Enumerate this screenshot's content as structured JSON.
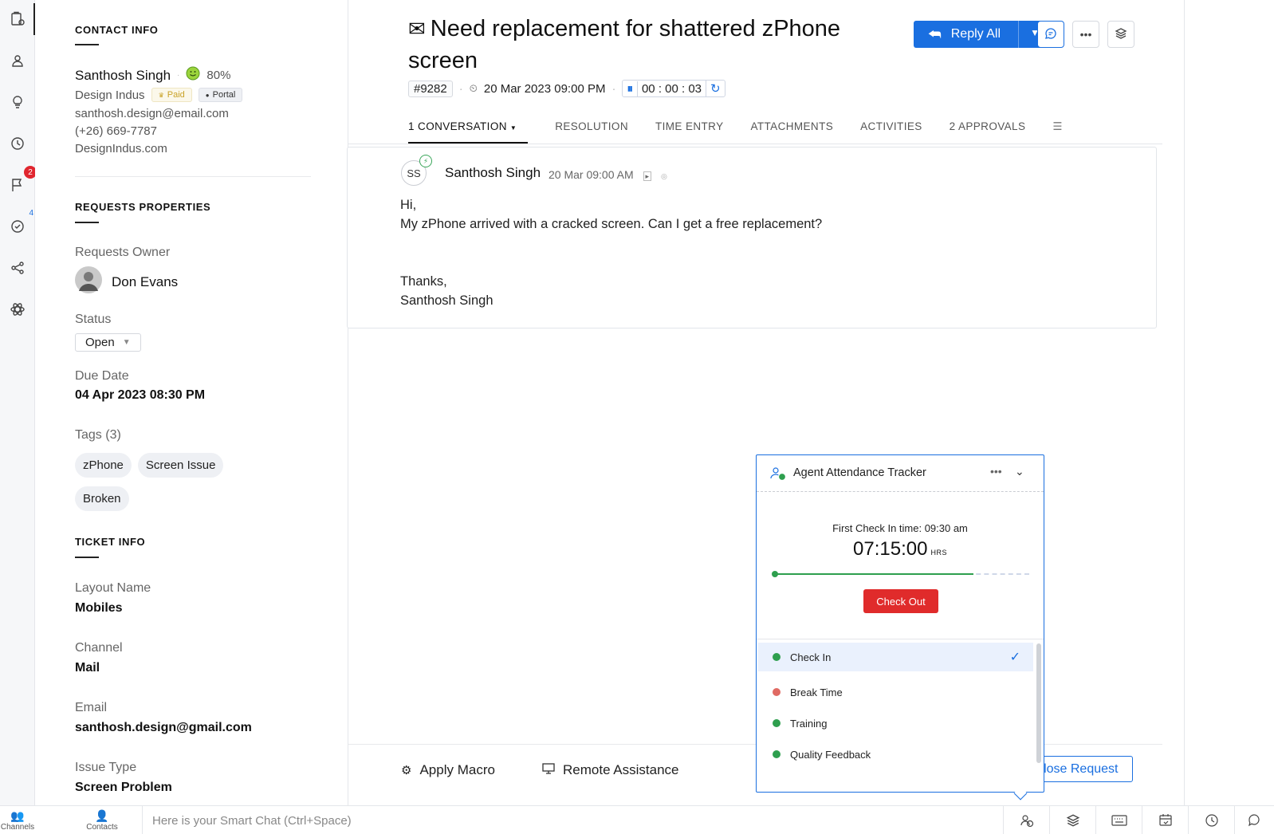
{
  "rail": {
    "items": [
      {
        "icon": "requests-icon"
      },
      {
        "icon": "bot-icon"
      },
      {
        "icon": "bulb-icon"
      },
      {
        "icon": "history-icon"
      },
      {
        "icon": "flag-icon",
        "badge": "2"
      },
      {
        "icon": "check-circle-icon",
        "count": "4"
      },
      {
        "icon": "share-icon"
      },
      {
        "icon": "atom-icon"
      }
    ]
  },
  "contact": {
    "section_title": "CONTACT INFO",
    "name": "Santhosh Singh",
    "happiness": "80%",
    "company": "Design Indus",
    "badge_paid": "Paid",
    "badge_portal": "Portal",
    "email": "santhosh.design@email.com",
    "phone": "(+26) 669-7787",
    "website": "DesignIndus.com"
  },
  "request_props": {
    "section_title": "REQUESTS PROPERTIES",
    "owner_label": "Requests Owner",
    "owner_name": "Don Evans",
    "status_label": "Status",
    "status_value": "Open",
    "due_label": "Due Date",
    "due_value": "04 Apr 2023 08:30 PM",
    "tags_label": "Tags (3)",
    "tags": [
      "zPhone",
      "Screen Issue",
      "Broken"
    ]
  },
  "ticket_info": {
    "section_title": "TICKET INFO",
    "layout_label": "Layout Name",
    "layout_value": "Mobiles",
    "channel_label": "Channel",
    "channel_value": "Mail",
    "email_label": "Email",
    "email_value": "santhosh.design@gmail.com",
    "issue_label": "Issue Type",
    "issue_value": "Screen Problem"
  },
  "ticket": {
    "title": "Need replacement for shattered zPhone screen",
    "id": "#9282",
    "created": "20 Mar 2023 09:00 PM",
    "timer": "00 : 00 : 03",
    "reply_label": "Reply All"
  },
  "tabs": [
    "1 CONVERSATION",
    "RESOLUTION",
    "TIME ENTRY",
    "ATTACHMENTS",
    "ACTIVITIES",
    "2 APPROVALS"
  ],
  "thread": {
    "initials": "SS",
    "sender": "Santhosh Singh",
    "time": "20 Mar 09:00 AM",
    "lines": [
      "Hi,",
      "My zPhone arrived with a cracked screen. Can I get a free replacement?",
      "",
      "",
      "Thanks,",
      "Santhosh Singh"
    ]
  },
  "bottom": {
    "macro": "Apply Macro",
    "remote": "Remote Assistance",
    "close": "Close Request"
  },
  "widget": {
    "title": "Agent Attendance Tracker",
    "first_check_in": "First Check In time: 09:30 am",
    "clock": "07:15:00",
    "clock_unit": "HRS",
    "progress": 0.78,
    "checkout": "Check Out",
    "items": [
      {
        "label": "Check In",
        "color": "#2e9f4e",
        "selected": true
      },
      {
        "label": "Break Time",
        "color": "#e06a63",
        "selected": false
      },
      {
        "label": "Training",
        "color": "#2e9f4e",
        "selected": false
      },
      {
        "label": "Quality Feedback",
        "color": "#2e9f4e",
        "selected": false
      }
    ]
  },
  "statusbar": {
    "channels": "Channels",
    "contacts": "Contacts",
    "smartchat_placeholder": "Here is your Smart Chat (Ctrl+Space)"
  },
  "colors": {
    "accent": "#1a6fe0",
    "danger": "#e02b2b",
    "success": "#2e9f4e"
  }
}
